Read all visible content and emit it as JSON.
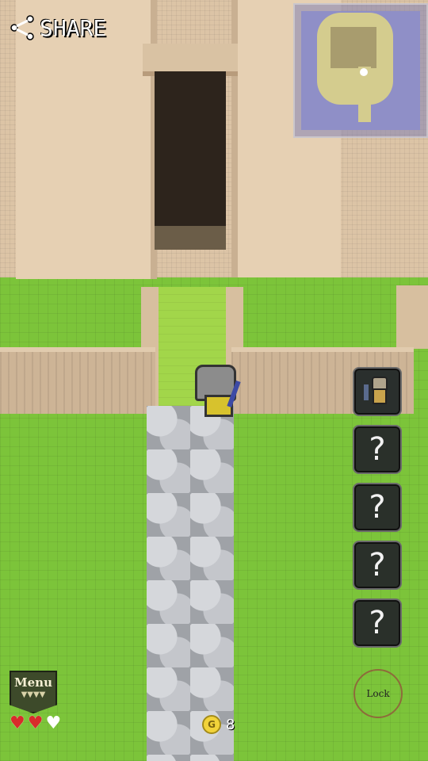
{
  "header": {
    "share_label": "SHARE"
  },
  "inventory": {
    "slots": [
      {
        "content": "hero",
        "label": ""
      },
      {
        "content": "unknown",
        "label": "?"
      },
      {
        "content": "unknown",
        "label": "?"
      },
      {
        "content": "unknown",
        "label": "?"
      },
      {
        "content": "unknown",
        "label": "?"
      }
    ]
  },
  "hud": {
    "menu_label": "Menu",
    "menu_chevrons": "▼▼▼▼",
    "hearts": {
      "full": 2,
      "max": 3
    },
    "heart_full": "♥",
    "heart_empty": "♥",
    "coin_symbol": "G",
    "coin_count": "8",
    "lock_label": "Lock"
  },
  "colors": {
    "grass": "#7cc43a",
    "castle": "#dcc4a6",
    "heart": "#d82b2b",
    "coin": "#f2d33a"
  }
}
